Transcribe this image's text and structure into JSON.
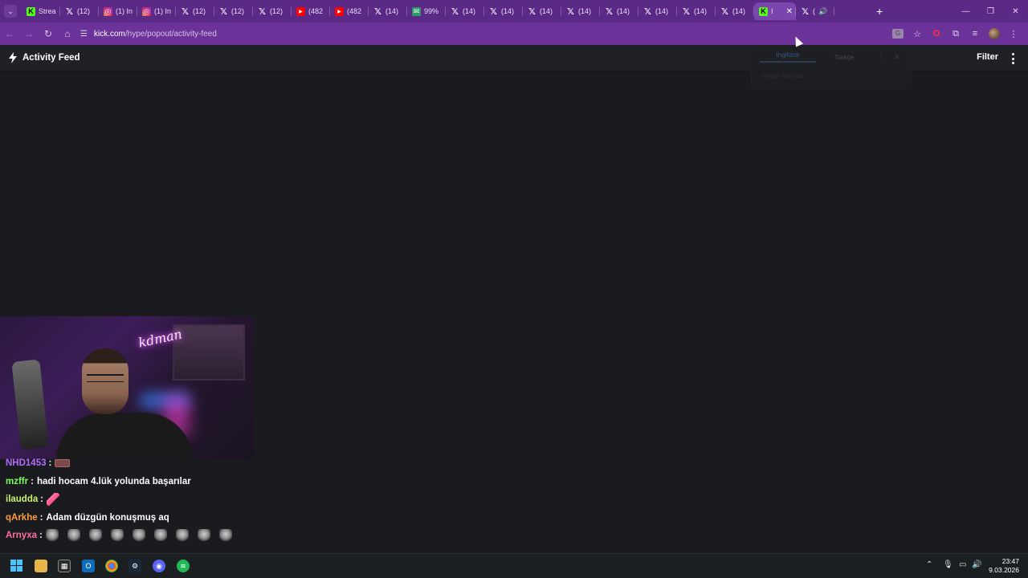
{
  "browser": {
    "tabs": [
      {
        "icon": "kick-icon",
        "label": "Strea"
      },
      {
        "icon": "x-icon",
        "label": "(12)"
      },
      {
        "icon": "instagram-icon",
        "label": "(1) In"
      },
      {
        "icon": "instagram-icon",
        "label": "(1) In"
      },
      {
        "icon": "x-icon",
        "label": "(12)"
      },
      {
        "icon": "x-icon",
        "label": "(12)"
      },
      {
        "icon": "x-icon",
        "label": "(12)"
      },
      {
        "icon": "youtube-icon",
        "label": "(482"
      },
      {
        "icon": "youtube-icon",
        "label": "(482"
      },
      {
        "icon": "x-icon",
        "label": "(14)"
      },
      {
        "icon": "mail-icon",
        "label": "99%"
      },
      {
        "icon": "x-icon",
        "label": "(14)"
      },
      {
        "icon": "x-icon",
        "label": "(14)"
      },
      {
        "icon": "x-icon",
        "label": "(14)"
      },
      {
        "icon": "x-icon",
        "label": "(14)"
      },
      {
        "icon": "x-icon",
        "label": "(14)"
      },
      {
        "icon": "x-icon",
        "label": "(14)"
      },
      {
        "icon": "x-icon",
        "label": "(14)"
      },
      {
        "icon": "x-icon",
        "label": "(14)"
      }
    ],
    "active_tab": {
      "icon": "kick-icon",
      "label": "I"
    },
    "last_tab": {
      "icon": "x-icon",
      "label": "("
    },
    "url_domain": "kick.com",
    "url_path": "/hype/popout/activity-feed"
  },
  "translate_popup": {
    "source_lang": "İngilizce",
    "target_lang": "Türkçe",
    "footer": "Google Translate"
  },
  "feed": {
    "title": "Activity Feed",
    "filter_label": "Filter"
  },
  "chat": [
    {
      "user": "NHD1453",
      "user_color": "#b46aff",
      "sep": ":",
      "text": "",
      "emotes": [
        "box"
      ]
    },
    {
      "user": "mzffr",
      "user_color": "#7cfc5a",
      "sep": ":",
      "text": "hadi hocam 4.lük yolunda başarılar",
      "emotes": []
    },
    {
      "user": "ilaudda",
      "user_color": "#c9f26b",
      "sep": ":",
      "text": "",
      "emotes": [
        "rocket"
      ]
    },
    {
      "user": "qArkhe",
      "user_color": "#ff9a3d",
      "sep": ":",
      "text": "Adam düzgün konuşmuş aq",
      "emotes": []
    },
    {
      "user": "Arnyxa",
      "user_color": "#ff6f9c",
      "sep": ":",
      "text": "",
      "emotes": [
        "skull",
        "skull",
        "skull",
        "skull",
        "skull",
        "skull",
        "skull",
        "skull",
        "skull"
      ]
    }
  ],
  "taskbar": {
    "time": "23:47",
    "date": "9.03.2026"
  }
}
